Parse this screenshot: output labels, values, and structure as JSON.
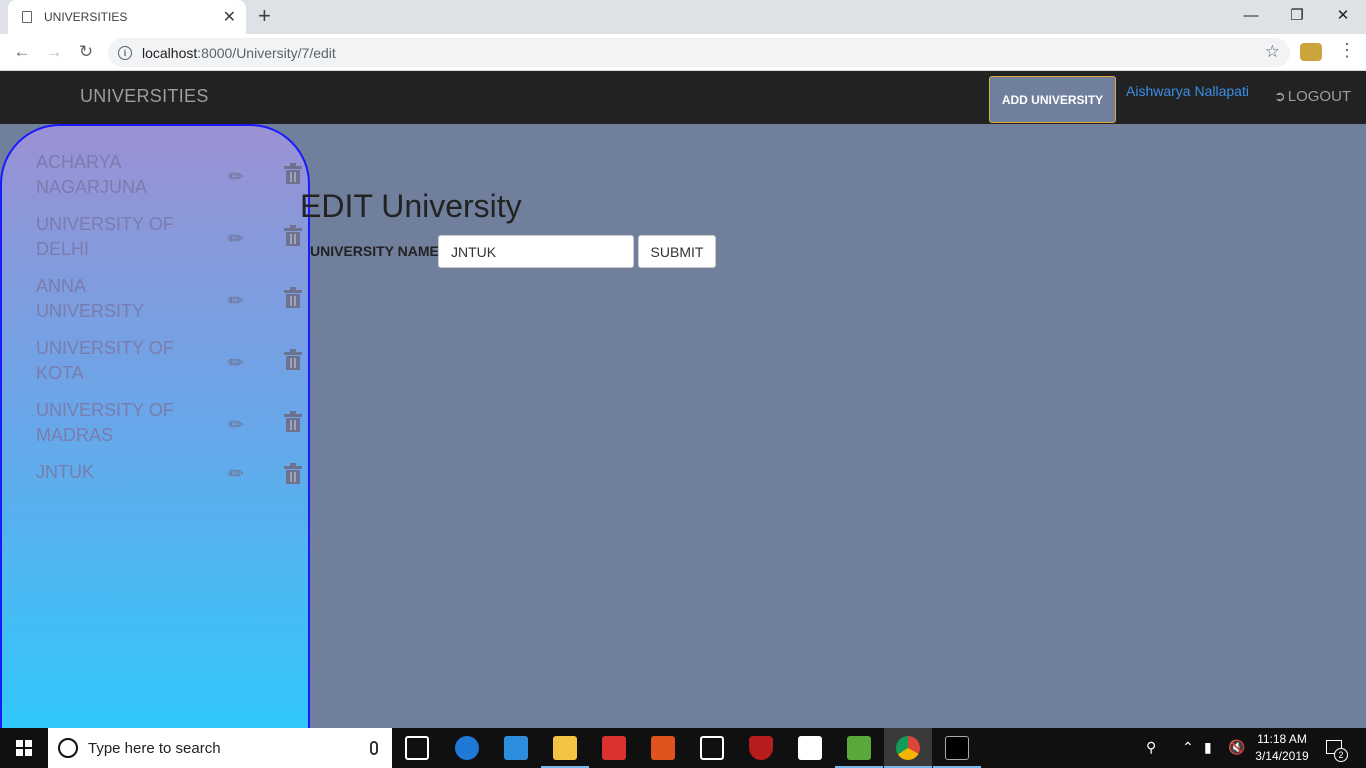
{
  "browser": {
    "tab_title": "UNIVERSITIES",
    "new_tab_symbol": "+",
    "url_host": "localhost",
    "url_path": ":8000/University/7/edit",
    "minimize": "—",
    "restore": "❐",
    "close": "✕"
  },
  "header": {
    "brand": "UNIVERSITIES",
    "add_button": "ADD UNIVERSITY",
    "user": "Aishwarya Nallapati",
    "logout": "LOGOUT"
  },
  "sidebar": {
    "items": [
      {
        "name": "ACHARYA NAGARJUNA"
      },
      {
        "name": "UNIVERSITY OF DELHI"
      },
      {
        "name": "ANNA UNIVERSITY"
      },
      {
        "name": "UNIVERSITY OF KOTA"
      },
      {
        "name": "UNIVERSITY OF MADRAS"
      },
      {
        "name": "JNTUK"
      }
    ]
  },
  "form": {
    "title": "EDIT University",
    "label": "UNIVERSITY NAME:",
    "value": "JNTUK",
    "submit": "SUBMIT"
  },
  "taskbar": {
    "search_placeholder": "Type here to search",
    "time": "11:18 AM",
    "date": "3/14/2019",
    "notification_count": "2"
  },
  "colors": {
    "page_bg": "#6f7f9c",
    "header_bg": "#222222",
    "add_button_border": "#e0a93c",
    "user_link": "#3a8ee6",
    "sidebar_border": "#1a1aff"
  }
}
